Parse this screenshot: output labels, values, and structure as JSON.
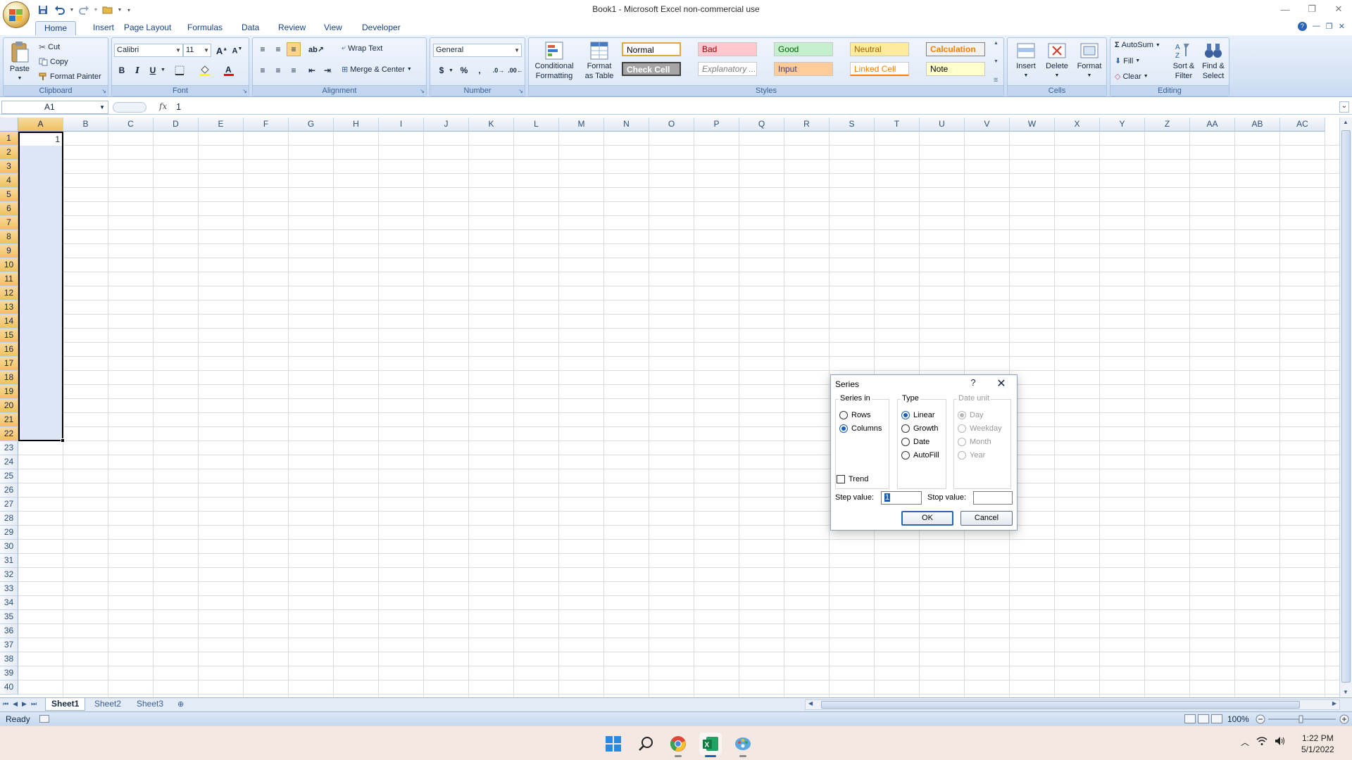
{
  "window": {
    "title": "Book1 - Microsoft Excel non-commercial use",
    "controls": [
      "minimize",
      "restore",
      "close"
    ]
  },
  "ribbon_tabs": [
    {
      "label": "Home",
      "active": true
    },
    {
      "label": "Insert",
      "active": false
    },
    {
      "label": "Page Layout",
      "active": false
    },
    {
      "label": "Formulas",
      "active": false
    },
    {
      "label": "Data",
      "active": false
    },
    {
      "label": "Review",
      "active": false
    },
    {
      "label": "View",
      "active": false
    },
    {
      "label": "Developer",
      "active": false
    }
  ],
  "clipboard": {
    "group": "Clipboard",
    "paste": "Paste",
    "cut": "Cut",
    "copy": "Copy",
    "format_painter": "Format Painter"
  },
  "font": {
    "group": "Font",
    "name": "Calibri",
    "size": "11",
    "bold": "B",
    "italic": "I",
    "underline": "U"
  },
  "alignment": {
    "group": "Alignment",
    "wrap_text": "Wrap Text",
    "merge_center": "Merge & Center"
  },
  "number": {
    "group": "Number",
    "format": "General",
    "currency": "$",
    "percent": "%",
    "comma": ","
  },
  "styles": {
    "group": "Styles",
    "conditional_1": "Conditional",
    "conditional_2": "Formatting",
    "format_table_1": "Format",
    "format_table_2": "as Table",
    "cells": [
      {
        "label": "Normal",
        "bg": "#ffffff",
        "fg": "#000000"
      },
      {
        "label": "Bad",
        "bg": "#ffc7ce",
        "fg": "#9c0006"
      },
      {
        "label": "Good",
        "bg": "#c6efce",
        "fg": "#006100"
      },
      {
        "label": "Neutral",
        "bg": "#ffeb9c",
        "fg": "#9c6500"
      },
      {
        "label": "Calculation",
        "bg": "#f2f2f2",
        "fg": "#fa7d00"
      },
      {
        "label": "Check Cell",
        "bg": "#a5a5a5",
        "fg": "#ffffff"
      },
      {
        "label": "Explanatory ...",
        "bg": "#ffffff",
        "fg": "#7f7f7f"
      },
      {
        "label": "Input",
        "bg": "#ffcc99",
        "fg": "#3f3f76"
      },
      {
        "label": "Linked Cell",
        "bg": "#ffffff",
        "fg": "#fa7d00"
      },
      {
        "label": "Note",
        "bg": "#ffffcc",
        "fg": "#000000"
      }
    ]
  },
  "cells_group": {
    "group": "Cells",
    "insert": "Insert",
    "delete": "Delete",
    "format": "Format"
  },
  "editing": {
    "group": "Editing",
    "autosum": "AutoSum",
    "fill": "Fill",
    "clear": "Clear",
    "sort_1": "Sort &",
    "sort_2": "Filter",
    "find_1": "Find &",
    "find_2": "Select"
  },
  "formula_bar": {
    "name_box": "A1",
    "fx": "fx",
    "value": "1"
  },
  "grid": {
    "columns": [
      "A",
      "B",
      "C",
      "D",
      "E",
      "F",
      "G",
      "H",
      "I",
      "J",
      "K",
      "L",
      "M",
      "N",
      "O",
      "P",
      "Q",
      "R",
      "S",
      "T",
      "U",
      "V",
      "W",
      "X",
      "Y",
      "Z",
      "AA",
      "AB",
      "AC"
    ],
    "rows": 40,
    "selected_rows": 22,
    "selected_col": "A",
    "cell_a1": "1"
  },
  "sheets": [
    {
      "label": "Sheet1",
      "active": true
    },
    {
      "label": "Sheet2",
      "active": false
    },
    {
      "label": "Sheet3",
      "active": false
    }
  ],
  "status": {
    "ready": "Ready",
    "zoom": "100%"
  },
  "dialog": {
    "title": "Series",
    "help": "?",
    "close": "✕",
    "series_in": {
      "legend": "Series in",
      "options": [
        {
          "label": "Rows",
          "checked": false
        },
        {
          "label": "Columns",
          "checked": true
        }
      ]
    },
    "type": {
      "legend": "Type",
      "options": [
        {
          "label": "Linear",
          "checked": true
        },
        {
          "label": "Growth",
          "checked": false
        },
        {
          "label": "Date",
          "checked": false
        },
        {
          "label": "AutoFill",
          "checked": false
        }
      ]
    },
    "date_unit": {
      "legend": "Date unit",
      "options": [
        {
          "label": "Day",
          "checked": true
        },
        {
          "label": "Weekday",
          "checked": false
        },
        {
          "label": "Month",
          "checked": false
        },
        {
          "label": "Year",
          "checked": false
        }
      ]
    },
    "trend": "Trend",
    "step_label": "Step value:",
    "step_value": "1",
    "stop_label": "Stop value:",
    "stop_value": "",
    "ok": "OK",
    "cancel": "Cancel"
  },
  "taskbar": {
    "time": "1:22 PM",
    "date": "5/1/2022"
  }
}
